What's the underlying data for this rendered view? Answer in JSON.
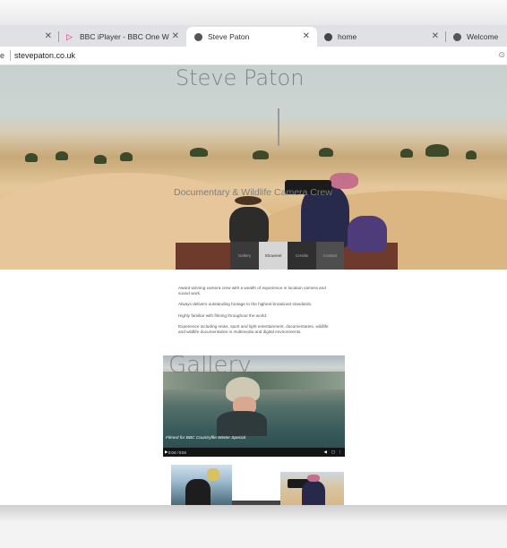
{
  "browser": {
    "tabs": [
      {
        "title": "",
        "active": false
      },
      {
        "title": "BBC iPlayer - BBC One West C",
        "active": false
      },
      {
        "title": "Steve Paton",
        "active": true
      },
      {
        "title": "home",
        "active": false
      },
      {
        "title": "Welcome",
        "active": false
      }
    ],
    "address_lead": "e",
    "url": "stevepaton.co.uk"
  },
  "site": {
    "title": "Steve Paton",
    "subtitle": "Documentary & Wildlife Camera Crew",
    "nav": [
      "Gallery",
      "Showreel",
      "Credits",
      "Contact"
    ],
    "paragraphs": [
      "Award winning camera crew with a wealth of experience in location camera and sound work.",
      "Always delivers outstanding footage to the highest broadcast standards.",
      "Highly familiar with filming throughout the world.",
      "Experience including news, sport and light entertainment, documentaries, wildlife and wildlife documentaries in multimedia and digital environments."
    ],
    "gallery_title": "Gallery",
    "video": {
      "caption": "Filmed for BBC Countryfile Winter Special",
      "time": "0:04 / 0:04"
    }
  },
  "colors": {
    "nav_gallery": "#3a3a3a",
    "nav_showreel": "#d6d6d6",
    "nav_credits": "#2f2f2f",
    "nav_contact": "#4e4e4e"
  }
}
